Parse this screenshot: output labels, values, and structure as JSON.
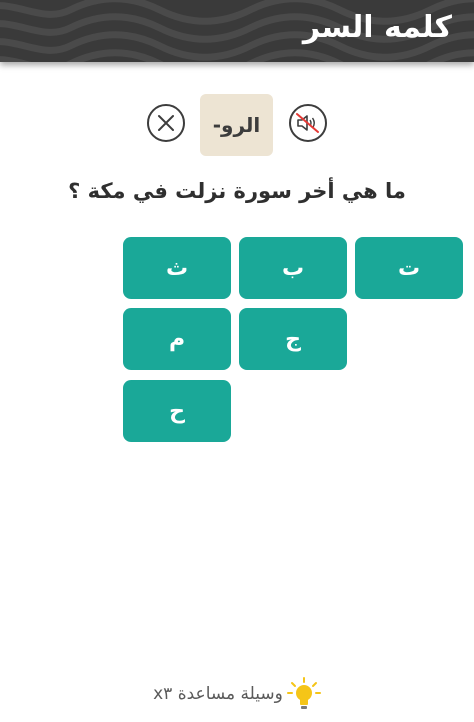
{
  "header": {
    "title": "كلمه السر"
  },
  "controls": {
    "answer_text": "الرو-",
    "close_icon": "close-icon",
    "sound_icon": "sound-muted-icon"
  },
  "question": "ما هي أخر سورة نزلت في مكة ؟",
  "letters": [
    "ت",
    "ب",
    "ث",
    "ج",
    "م",
    "ح"
  ],
  "hint": {
    "label": "وسيلة مساعدة x٣",
    "icon": "lightbulb-icon"
  },
  "colors": {
    "header_bg": "#3a3a3a",
    "letter_bg": "#1aa898",
    "answer_bg": "#ede4d3",
    "bulb": "#f5c518"
  }
}
